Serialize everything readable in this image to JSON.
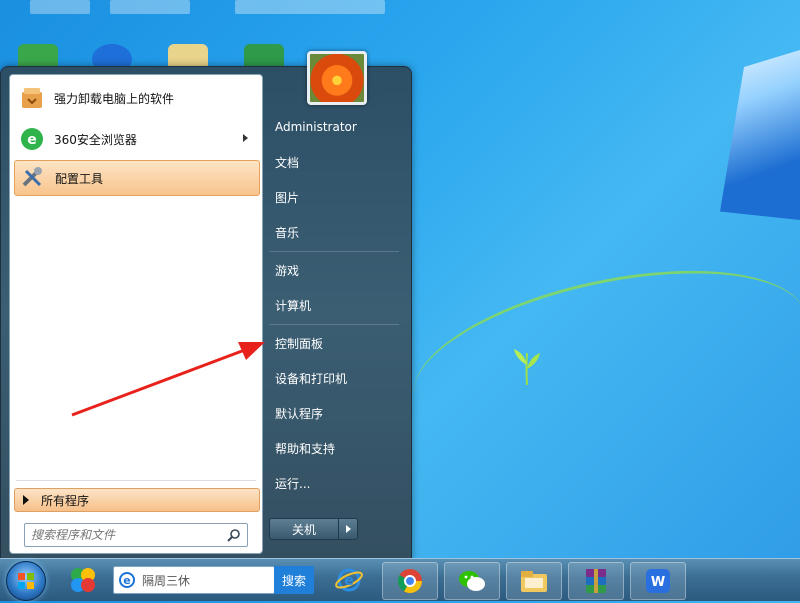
{
  "start_menu": {
    "programs": [
      {
        "label": "强力卸载电脑上的软件",
        "icon": "uninstall-box-icon"
      },
      {
        "label": "360安全浏览器",
        "icon": "360-browser-icon",
        "has_submenu": true
      },
      {
        "label": "配置工具",
        "icon": "config-tools-icon",
        "highlighted": true
      }
    ],
    "all_programs": "所有程序",
    "search_placeholder": "搜索程序和文件",
    "user": "Administrator",
    "right_items": [
      "文档",
      "图片",
      "音乐",
      "游戏",
      "计算机",
      "控制面板",
      "设备和打印机",
      "默认程序",
      "帮助和支持",
      "运行..."
    ],
    "shutdown": "关机"
  },
  "taskbar": {
    "search_value": "隔周三休",
    "search_button": "搜索",
    "apps": [
      "start-orb",
      "360-ball-icon",
      "ie-icon",
      "chrome-icon",
      "wechat-icon",
      "file-explorer-icon",
      "winrar-icon",
      "wps-icon"
    ]
  },
  "colors": {
    "desktop": "#2aa6ee",
    "highlight": "#f8c48c",
    "annotation": "#e8221b",
    "search_button": "#1f7fd9"
  }
}
